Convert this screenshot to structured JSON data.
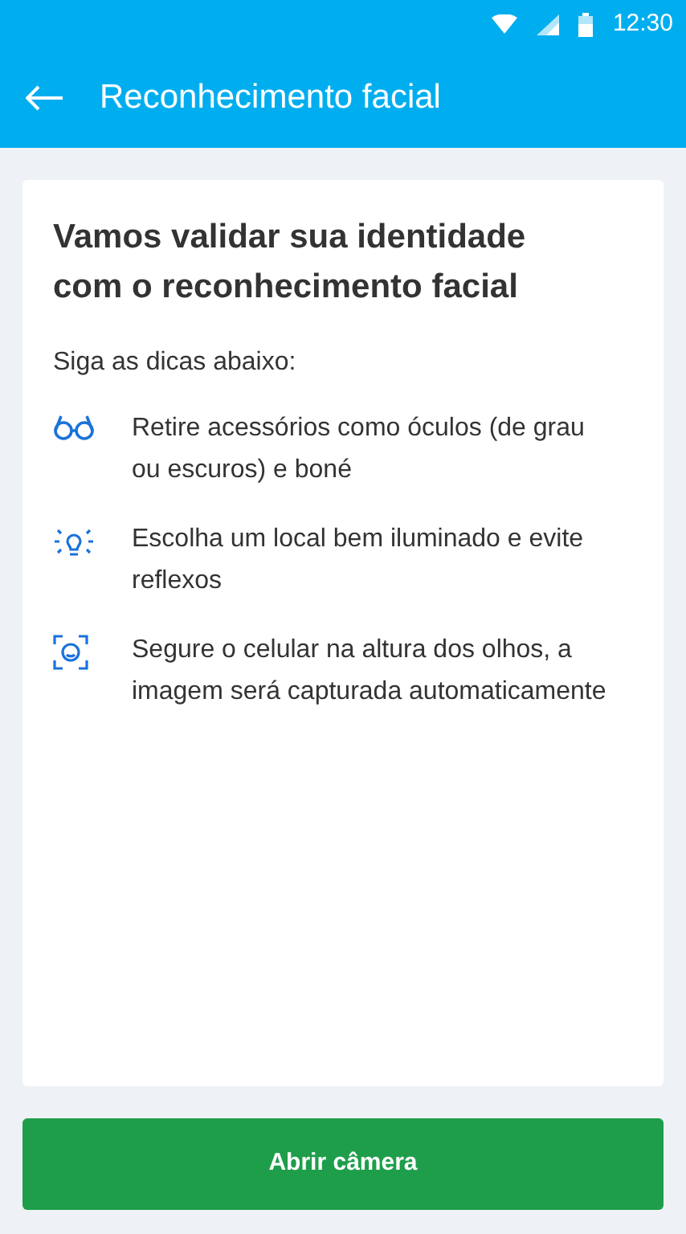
{
  "status_bar": {
    "time": "12:30"
  },
  "header": {
    "title": "Reconhecimento facial"
  },
  "card": {
    "heading": "Vamos validar sua identidade com o reconhecimento facial",
    "intro": "Siga as dicas abaixo:",
    "tips": [
      {
        "kind": "glasses",
        "text": "Retire acessórios como óculos (de grau ou escuros) e boné"
      },
      {
        "kind": "bulb",
        "text": "Escolha um local bem iluminado e evite reflexos"
      },
      {
        "kind": "face",
        "text": "Segure o celular na altura dos olhos, a imagem será capturada automaticamente"
      }
    ]
  },
  "button": {
    "label": "Abrir câmera"
  }
}
